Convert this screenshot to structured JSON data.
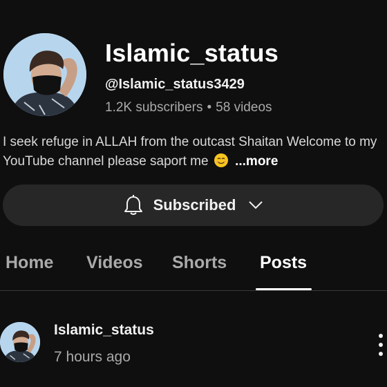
{
  "channel": {
    "name": "Islamic_status",
    "handle": "@Islamic_status3429",
    "subscribers": "1.2K subscribers",
    "separator": "•",
    "videos": "58 videos",
    "description": "I seek refuge in ALLAH from the outcast Shaitan Welcome to my YouTube channel please saport me",
    "description_emoji": "smiling-face-icon",
    "more_label": "...more"
  },
  "subscribe_button": {
    "label": "Subscribed",
    "icon": "bell-icon",
    "dropdown_icon": "chevron-down-icon"
  },
  "tabs": [
    {
      "label": "Home",
      "active": false
    },
    {
      "label": "Videos",
      "active": false
    },
    {
      "label": "Shorts",
      "active": false
    },
    {
      "label": "Posts",
      "active": true
    }
  ],
  "post": {
    "author": "Islamic_status",
    "time": "7 hours ago",
    "menu_icon": "more-vertical-icon"
  },
  "colors": {
    "background": "#0f0f0f",
    "button_background": "#272727",
    "primary_text": "#f1f1f1",
    "secondary_text": "#aaaaaa",
    "active_tab_indicator": "#ffffff"
  }
}
